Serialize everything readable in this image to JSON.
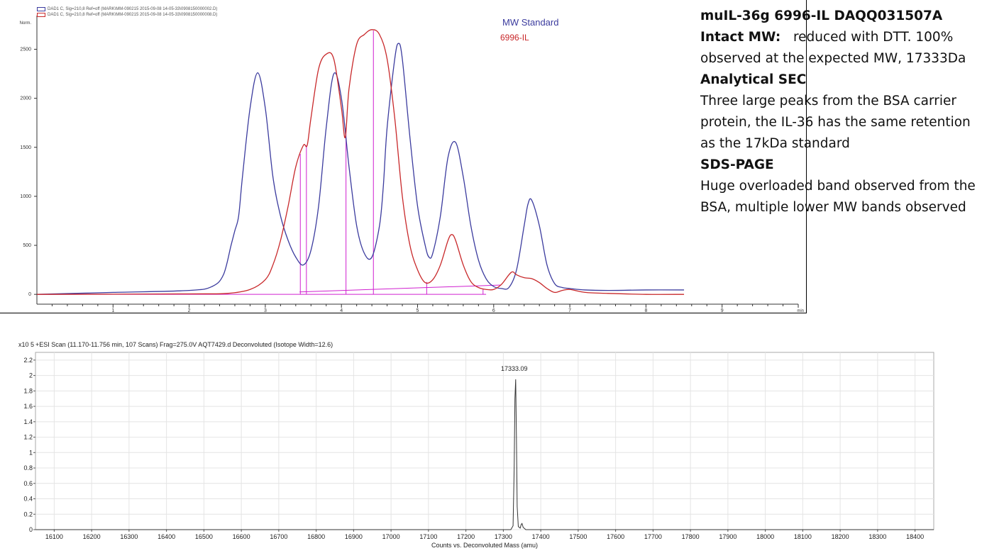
{
  "notes": {
    "title": "muIL-36g 6996-IL DAQQ031507A",
    "intact_label": "Intact MW:",
    "intact_text": "reduced with DTT. 100% observed at the expected MW, 17333Da",
    "sec_label": "Analytical SEC",
    "sec_text": "Three large peaks from the BSA carrier protein, the IL-36 has the same retention as the 17kDa standard",
    "sds_label": "SDS-PAGE",
    "sds_text": "Huge overloaded band observed from the BSA, multiple lower MW bands observed"
  },
  "chart_data": [
    {
      "type": "line",
      "legend": [
        "DAD1 C, Sig=210,8 Ref=off (MARK\\MM-090215 2015-09-08 14-05-33\\0908150000002.D)",
        "DAD1 C, Sig=210,8 Ref=off (MARK\\MM-090215 2015-09-08 14-05-33\\0908150000008.D)"
      ],
      "annotations": [
        "MW Standard",
        "6996-IL"
      ],
      "ylabel": "Norm.",
      "xunit": "min",
      "xlim": [
        0,
        10
      ],
      "ylim": [
        -100,
        2800
      ],
      "xticks": [
        1,
        2,
        3,
        4,
        5,
        6,
        7,
        8,
        9
      ],
      "yticks": [
        0,
        500,
        1000,
        1500,
        2000,
        2500
      ],
      "colors": {
        "standard": "#3b3b9e",
        "sample": "#c8282a",
        "integration": "#d020d0"
      },
      "series": [
        {
          "name": "MW Standard",
          "x": [
            0.0,
            1.0,
            2.0,
            2.3,
            2.45,
            2.55,
            2.6,
            2.65,
            2.7,
            2.8,
            2.9,
            3.0,
            3.1,
            3.2,
            3.3,
            3.4,
            3.5,
            3.6,
            3.7,
            3.8,
            3.9,
            4.0,
            4.1,
            4.2,
            4.3,
            4.4,
            4.5,
            4.55,
            4.6,
            4.7,
            4.75,
            4.8,
            4.9,
            5.0,
            5.1,
            5.15,
            5.2,
            5.3,
            5.4,
            5.5,
            5.6,
            5.7,
            5.8,
            5.9,
            6.0,
            6.1,
            6.2,
            6.3,
            6.4,
            6.45,
            6.5,
            6.6,
            6.7,
            6.8,
            6.9,
            7.0,
            7.2,
            7.5,
            8.0,
            8.5
          ],
          "y": [
            0,
            20,
            40,
            80,
            200,
            500,
            650,
            800,
            1200,
            1900,
            2260,
            1900,
            1200,
            800,
            550,
            380,
            300,
            450,
            900,
            1700,
            2250,
            2000,
            1300,
            700,
            420,
            380,
            700,
            1100,
            1700,
            2400,
            2560,
            2400,
            1600,
            900,
            500,
            380,
            420,
            800,
            1400,
            1550,
            1200,
            700,
            350,
            160,
            80,
            60,
            70,
            250,
            700,
            920,
            960,
            700,
            300,
            110,
            70,
            60,
            45,
            40,
            45,
            45
          ]
        },
        {
          "name": "6996-IL",
          "x": [
            0.0,
            2.0,
            2.5,
            2.8,
            3.0,
            3.1,
            3.2,
            3.3,
            3.4,
            3.5,
            3.55,
            3.6,
            3.7,
            3.8,
            3.9,
            4.0,
            4.05,
            4.1,
            4.2,
            4.3,
            4.4,
            4.5,
            4.6,
            4.7,
            4.8,
            4.9,
            5.0,
            5.1,
            5.2,
            5.3,
            5.4,
            5.45,
            5.5,
            5.6,
            5.7,
            5.8,
            5.9,
            6.0,
            6.1,
            6.2,
            6.25,
            6.3,
            6.4,
            6.5,
            6.6,
            6.7,
            6.8,
            6.9,
            7.0,
            7.2,
            7.5,
            8.0,
            8.5
          ],
          "y": [
            0,
            5,
            10,
            50,
            150,
            300,
            550,
            900,
            1300,
            1520,
            1520,
            1800,
            2300,
            2450,
            2400,
            1900,
            1600,
            2100,
            2550,
            2650,
            2700,
            2650,
            2400,
            1800,
            1000,
            500,
            250,
            120,
            150,
            300,
            550,
            610,
            550,
            300,
            130,
            70,
            50,
            50,
            100,
            200,
            230,
            200,
            170,
            160,
            120,
            60,
            20,
            40,
            50,
            20,
            10,
            0,
            0
          ]
        }
      ]
    },
    {
      "type": "line",
      "title": "+ESI Scan (11.170-11.756 min, 107 Scans) Frag=275.0V AQT7429.d  Deconvoluted (Isotope Width=12.6)",
      "xlabel": "Counts vs. Deconvoluted Mass (amu)",
      "yexponent": "x10 5",
      "xlim": [
        16050,
        18450
      ],
      "ylim": [
        0,
        2.3
      ],
      "xticks": [
        16100,
        16200,
        16300,
        16400,
        16500,
        16600,
        16700,
        16800,
        16900,
        17000,
        17100,
        17200,
        17300,
        17400,
        17500,
        17600,
        17700,
        17800,
        17900,
        18000,
        18100,
        18200,
        18300,
        18400
      ],
      "yticks": [
        0,
        0.2,
        0.4,
        0.6,
        0.8,
        1,
        1.2,
        1.4,
        1.6,
        1.8,
        2,
        2.2
      ],
      "peak_label": "17333.09",
      "series": [
        {
          "x": [
            16050,
            17320,
            17326,
            17329,
            17331,
            17333,
            17335,
            17337,
            17340,
            17345,
            17348,
            17350,
            17353,
            17360,
            18450
          ],
          "y": [
            0,
            0,
            0.05,
            0.8,
            1.7,
            1.95,
            1.2,
            0.3,
            0.04,
            0.02,
            0.07,
            0.08,
            0.03,
            0,
            0
          ]
        }
      ]
    }
  ]
}
